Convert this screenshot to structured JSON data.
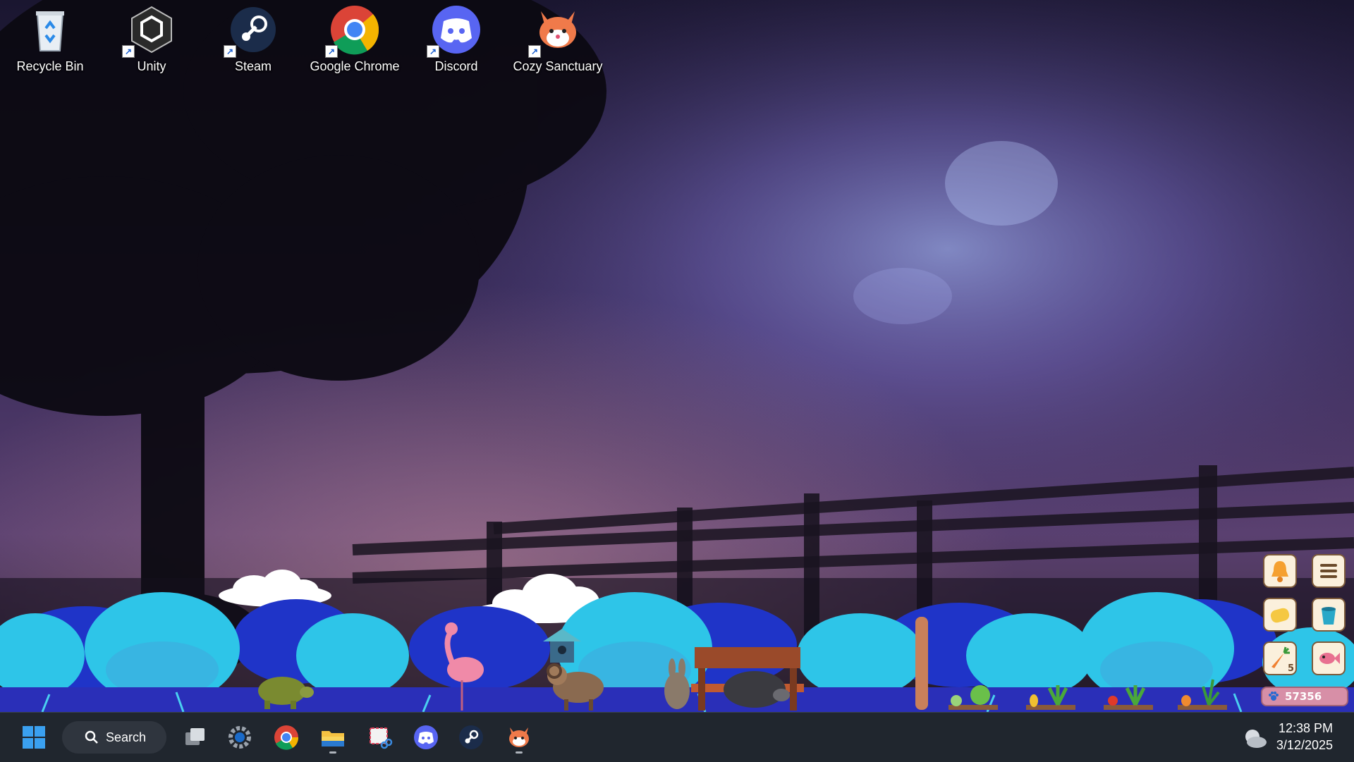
{
  "desktop": {
    "icons": [
      {
        "label": "Recycle Bin",
        "icon": "recycle-bin-icon"
      },
      {
        "label": "Unity",
        "icon": "unity-icon"
      },
      {
        "label": "Steam",
        "icon": "steam-icon"
      },
      {
        "label": "Google Chrome",
        "icon": "chrome-icon"
      },
      {
        "label": "Discord",
        "icon": "discord-icon"
      },
      {
        "label": "Cozy Sanctuary",
        "icon": "fox-icon"
      }
    ]
  },
  "game": {
    "buttons": [
      {
        "icon": "bell-icon"
      },
      {
        "icon": "menu-icon"
      },
      {
        "icon": "sponge-icon"
      },
      {
        "icon": "bucket-icon"
      },
      {
        "icon": "carrot-icon",
        "count": "5"
      },
      {
        "icon": "fish-icon"
      }
    ],
    "currency_value": "57356",
    "currency_icon": "paw-icon",
    "animals": [
      "turtle",
      "flamingo",
      "ram",
      "rabbit",
      "hedgehog"
    ],
    "crops": [
      "lettuce",
      "corn",
      "tomato",
      "carrot"
    ]
  },
  "taskbar": {
    "start_icon": "windows-start-icon",
    "search_label": "Search",
    "apps": [
      {
        "icon": "task-view-icon"
      },
      {
        "icon": "settings-gear-icon"
      },
      {
        "icon": "chrome-icon"
      },
      {
        "icon": "file-explorer-icon",
        "running": true
      },
      {
        "icon": "snipping-tool-icon"
      },
      {
        "icon": "discord-icon"
      },
      {
        "icon": "steam-icon"
      },
      {
        "icon": "fox-icon",
        "running": true
      }
    ],
    "weather_icon": "cloud-moon-icon",
    "time": "12:38 PM",
    "date": "3/12/2025"
  },
  "colors": {
    "taskbar_bg": "#20262e",
    "sky_top": "#241a3a",
    "tree_cyan": "#2ec5e8",
    "tree_blue": "#1f34c8",
    "game_button_bg": "#fbf0dc",
    "currency_bg": "#d78fa7"
  }
}
